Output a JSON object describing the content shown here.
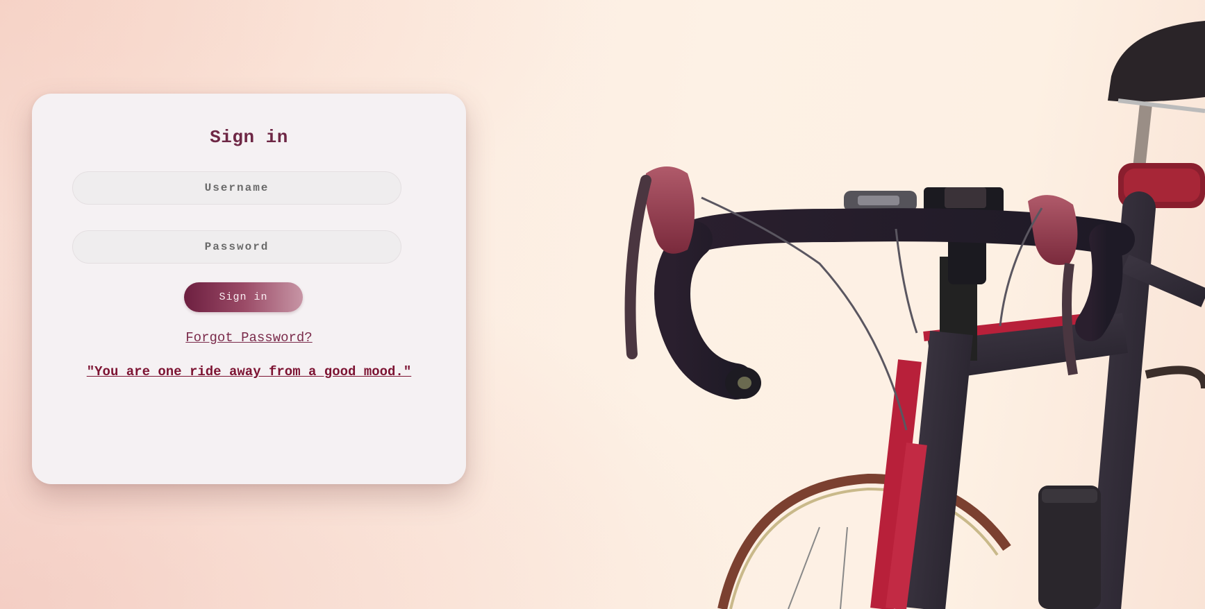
{
  "page": {
    "background_image": "road-bicycle-photo"
  },
  "login": {
    "title": "Sign in",
    "username_placeholder": "Username",
    "password_placeholder": "Password",
    "submit_label": "Sign in",
    "forgot_label": "Forgot Password?",
    "quote": "\"You are one ride away from a good mood.\""
  },
  "colors": {
    "accent": "#6e2745",
    "button_start": "#6d1f40",
    "button_end": "#c795a5",
    "card_bg": "#f5f1f3"
  }
}
